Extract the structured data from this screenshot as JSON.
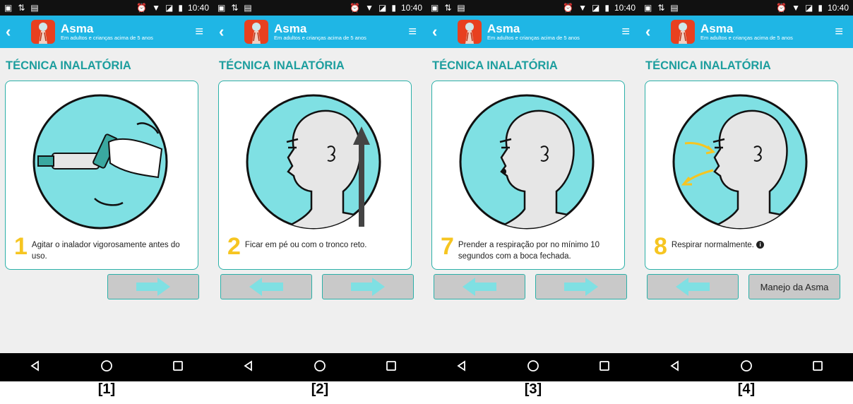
{
  "status_bar": {
    "time": "10:40"
  },
  "app": {
    "title": "Asma",
    "subtitle": "Em adultos e crianças acima de 5 anos",
    "back_icon": "chevron-left-icon",
    "menu_icon": "hamburger-menu-icon"
  },
  "section_title": "TÉCNICA INALATÓRIA",
  "colors": {
    "appbar": "#1fb6e5",
    "accent": "#1d9e9e",
    "circle": "#7fe0e3",
    "step_number": "#f6c521",
    "arrow": "#7fe0e3"
  },
  "screens": [
    {
      "caption": "[1]",
      "step_number": "1",
      "step_text": "Agitar o inalador vigorosamente antes do uso.",
      "info": false,
      "buttons": [
        {
          "type": "arrow-right",
          "name": "next-button"
        }
      ]
    },
    {
      "caption": "[2]",
      "step_number": "2",
      "step_text": "Ficar em pé ou com o tronco reto.",
      "info": false,
      "buttons": [
        {
          "type": "arrow-left",
          "name": "previous-button"
        },
        {
          "type": "arrow-right",
          "name": "next-button"
        }
      ]
    },
    {
      "caption": "[3]",
      "step_number": "7",
      "step_text": "Prender a respiração por no mínimo 10 segundos com a boca fechada.",
      "info": false,
      "buttons": [
        {
          "type": "arrow-left",
          "name": "previous-button"
        },
        {
          "type": "arrow-right",
          "name": "next-button"
        }
      ]
    },
    {
      "caption": "[4]",
      "step_number": "8",
      "step_text": "Respirar normalmente.",
      "info": true,
      "buttons": [
        {
          "type": "arrow-left",
          "name": "previous-button"
        },
        {
          "type": "text",
          "name": "manejo-asma-button",
          "label": "Manejo da Asma"
        }
      ]
    }
  ],
  "nav_bar": {
    "back": "triangle-back-icon",
    "home": "circle-home-icon",
    "recents": "square-recents-icon"
  }
}
